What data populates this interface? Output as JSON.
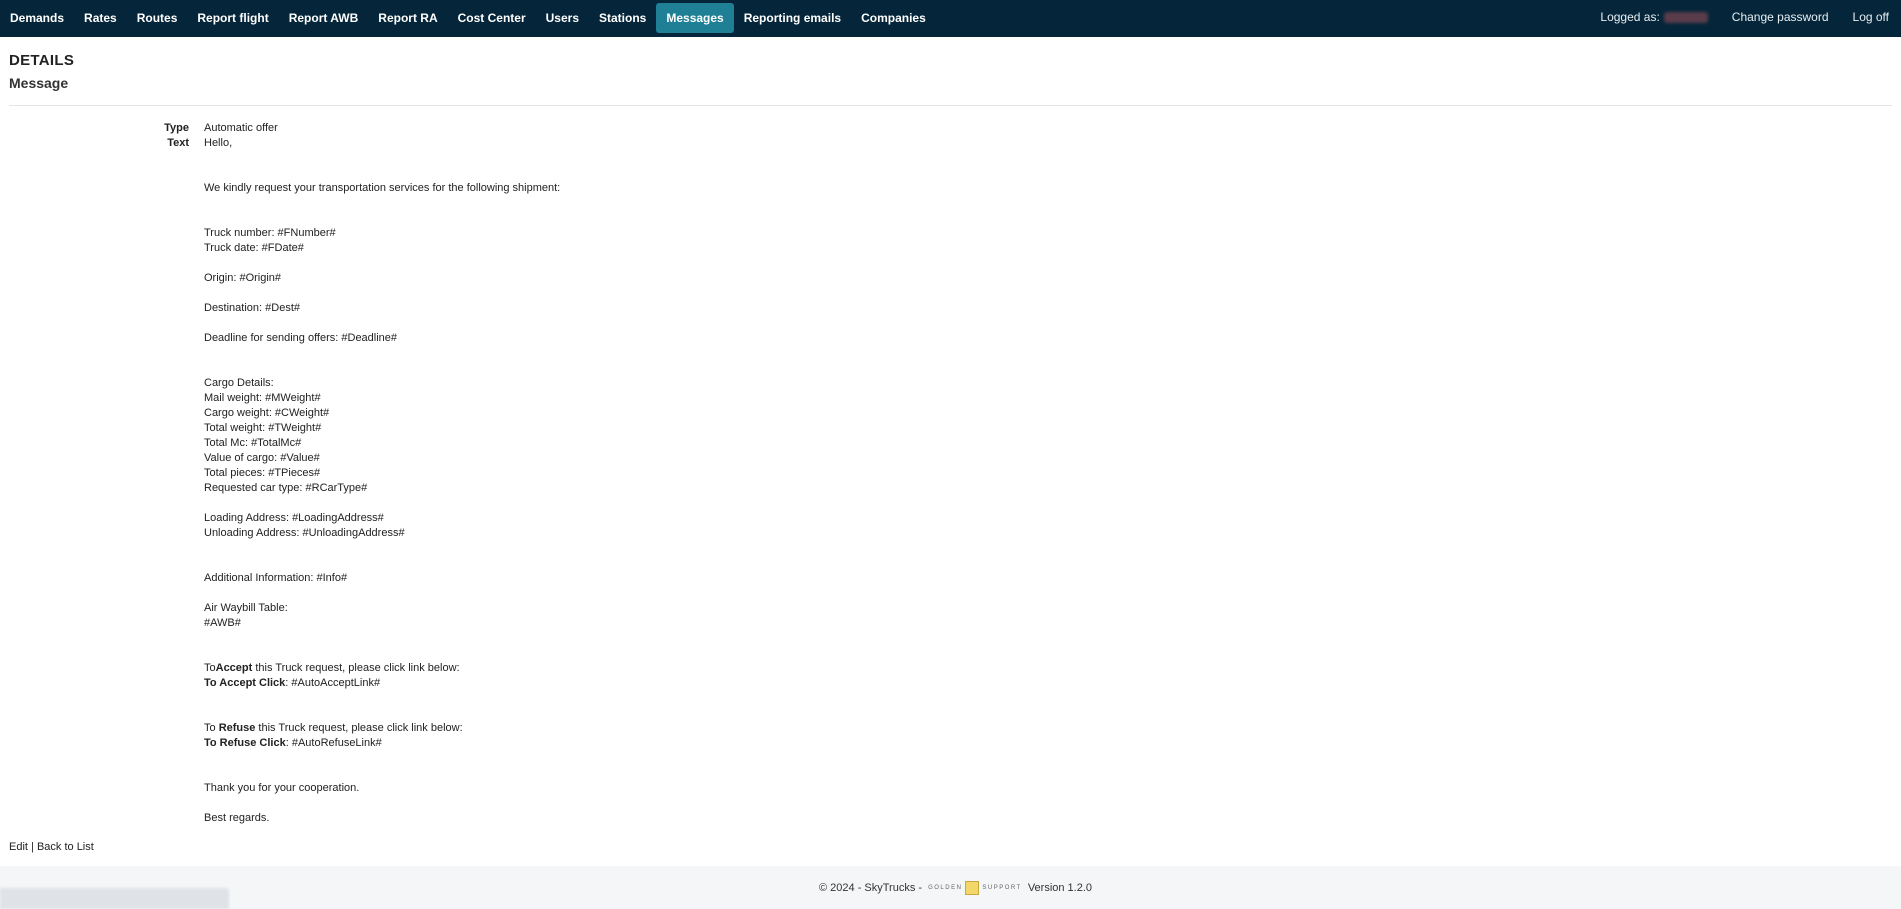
{
  "nav": {
    "items": [
      {
        "label": "Demands",
        "active": false
      },
      {
        "label": "Rates",
        "active": false
      },
      {
        "label": "Routes",
        "active": false
      },
      {
        "label": "Report flight",
        "active": false
      },
      {
        "label": "Report AWB",
        "active": false
      },
      {
        "label": "Report RA",
        "active": false
      },
      {
        "label": "Cost Center",
        "active": false
      },
      {
        "label": "Users",
        "active": false
      },
      {
        "label": "Stations",
        "active": false
      },
      {
        "label": "Messages",
        "active": true
      },
      {
        "label": "Reporting emails",
        "active": false
      },
      {
        "label": "Companies",
        "active": false
      }
    ],
    "logged_as": "Logged as:",
    "change_password": "Change password",
    "log_off": "Log off"
  },
  "page": {
    "title": "DETAILS",
    "subtitle": "Message"
  },
  "details": {
    "type_label": "Type",
    "type_value": "Automatic offer",
    "text_label": "Text",
    "text": {
      "hello": "Hello,",
      "request": "We kindly request your transportation services for the following shipment:",
      "truck_number": "Truck number: #FNumber#",
      "truck_date": "Truck date: #FDate#",
      "origin": "Origin: #Origin#",
      "destination": "Destination: #Dest#",
      "deadline": "Deadline for sending offers: #Deadline#",
      "cargo_details": "Cargo Details:",
      "mail_weight": "Mail weight: #MWeight#",
      "cargo_weight": "Cargo weight: #CWeight#",
      "total_weight": "Total weight: #TWeight#",
      "total_mc": "Total Mc: #TotalMc#",
      "value_of_cargo": "Value of cargo: #Value#",
      "total_pieces": "Total pieces: #TPieces#",
      "car_type": "Requested car type: #RCarType#",
      "loading_address": "Loading Address: #LoadingAddress#",
      "unloading_address": "Unloading Address: #UnloadingAddress#",
      "additional_info": "Additional Information: #Info#",
      "awb_table": "Air Waybill Table:",
      "awb": "#AWB#",
      "accept_to": "To",
      "accept_word": "Accept",
      "accept_rest": " this Truck request, please click link below:",
      "accept_click_label": "To Accept Click",
      "accept_click_value": ": #AutoAcceptLink#",
      "refuse_to": "To ",
      "refuse_word": "Refuse",
      "refuse_rest": " this Truck request, please click link below:",
      "refuse_click_label": "To Refuse Click",
      "refuse_click_value": ": #AutoRefuseLink#",
      "thanks": "Thank you for your cooperation.",
      "regards": "Best regards."
    }
  },
  "actions": {
    "edit": "Edit",
    "separator": " | ",
    "back": "Back to List"
  },
  "footer": {
    "copyright": "© 2024 - SkyTrucks -",
    "logo_left": "GOLDEN",
    "logo_right": "SUPPORT",
    "version": "Version 1.2.0"
  }
}
